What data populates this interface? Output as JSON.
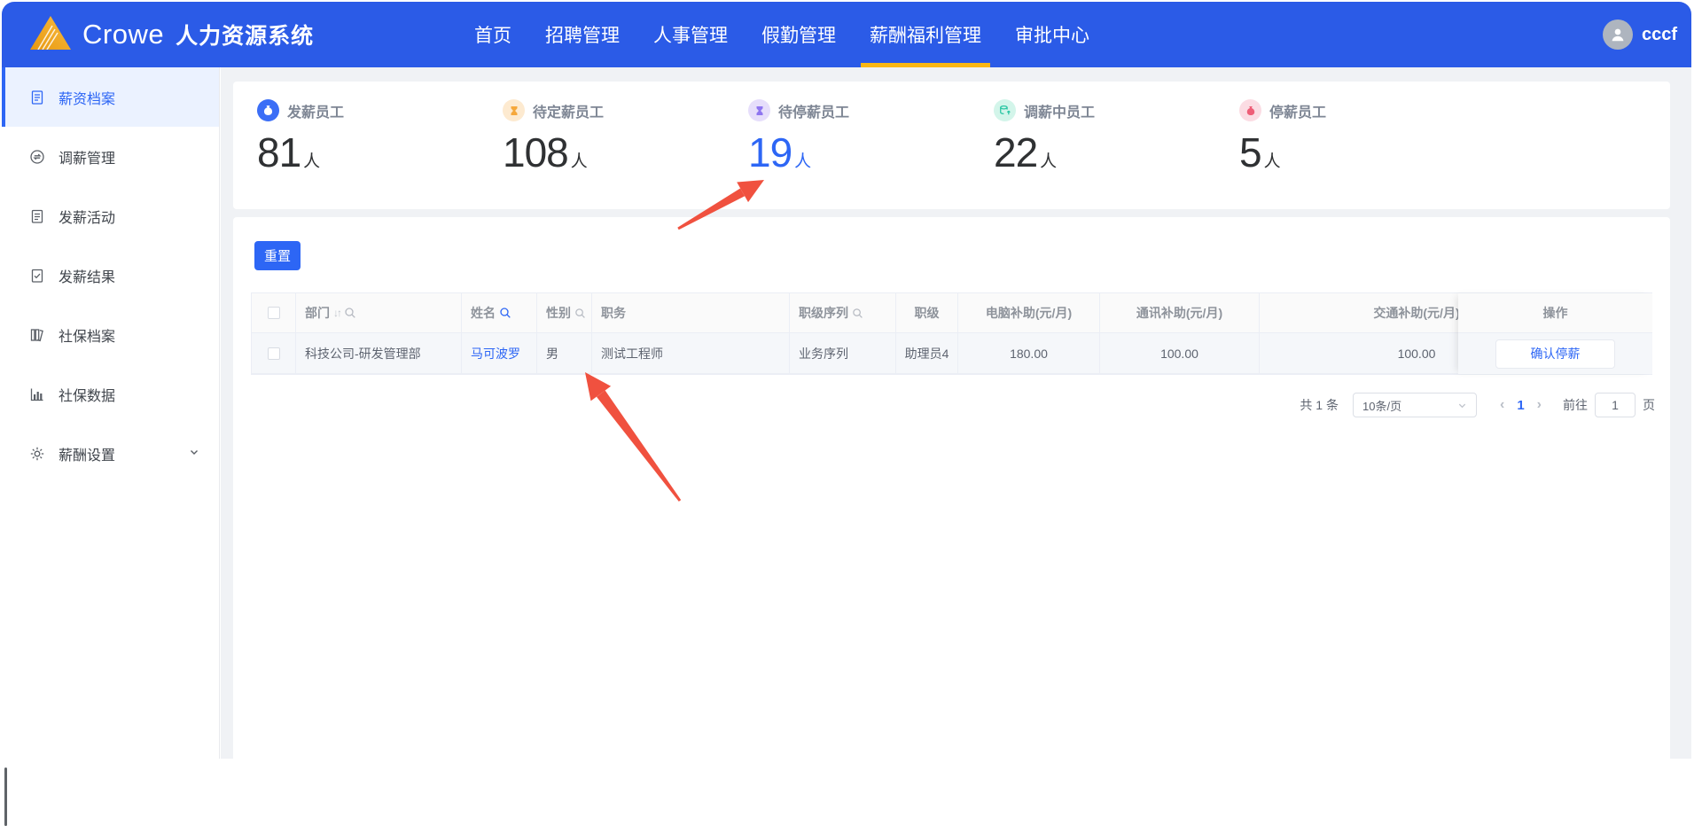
{
  "app": {
    "brand": "Crowe",
    "title": "人力资源系统",
    "user": "cccf"
  },
  "nav": {
    "items": [
      "首页",
      "招聘管理",
      "人事管理",
      "假勤管理",
      "薪酬福利管理",
      "审批中心"
    ],
    "active": "薪酬福利管理"
  },
  "sidebar": {
    "items": [
      "薪资档案",
      "调薪管理",
      "发薪活动",
      "发薪结果",
      "社保档案",
      "社保数据",
      "薪酬设置"
    ],
    "active": "薪资档案"
  },
  "stats": {
    "unit": "人",
    "items": [
      {
        "label": "发薪员工",
        "value": "81"
      },
      {
        "label": "待定薪员工",
        "value": "108"
      },
      {
        "label": "待停薪员工",
        "value": "19",
        "highlighted": true
      },
      {
        "label": "调薪中员工",
        "value": "22"
      },
      {
        "label": "停薪员工",
        "value": "5"
      }
    ]
  },
  "toolbar": {
    "reset": "重置"
  },
  "table": {
    "headers": [
      {
        "label": "部门",
        "sortable": true,
        "searchable": true
      },
      {
        "label": "姓名",
        "searchable": true,
        "search_active": true
      },
      {
        "label": "性别",
        "searchable": true
      },
      {
        "label": "职务"
      },
      {
        "label": "职级序列",
        "searchable": true
      },
      {
        "label": "职级"
      },
      {
        "label": "电脑补助(元/月)"
      },
      {
        "label": "通讯补助(元/月)"
      },
      {
        "label": "交通补助(元/月)"
      },
      {
        "label": "操作"
      }
    ],
    "row": {
      "department": "科技公司-研发管理部",
      "name": "马可波罗",
      "gender": "男",
      "position": "测试工程师",
      "rank_series": "业务序列",
      "rank": "助理员4",
      "computer_allowance": "180.00",
      "communication_allowance": "100.00",
      "transport_allowance": "100.00",
      "action": "确认停薪"
    }
  },
  "pagination": {
    "total": "共 1 条",
    "page_size": "10条/页",
    "current_page": "1",
    "goto_label": "前往",
    "goto_value": "1",
    "page_unit": "页"
  },
  "colors": {
    "primary": "#2D66F5",
    "nav_bg": "#2B5BE7",
    "active_tab_underline": "#FAB714",
    "annotation_arrow": "#F0513F",
    "stat_icon_payroll": "#3B6EF6",
    "stat_icon_pending_salary": "#F5A83C",
    "stat_icon_pending_stop": "#8F76F0",
    "stat_icon_adjusting": "#2BC6A4",
    "stat_icon_stopped": "#EE5E77"
  }
}
